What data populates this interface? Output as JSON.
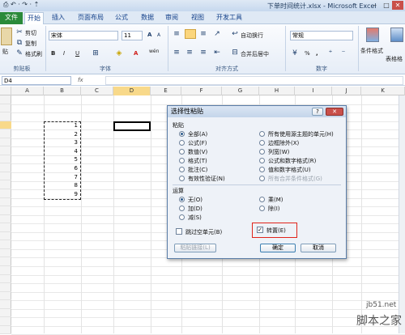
{
  "window": {
    "title": "下单时间统计.xlsx - Microsoft Excel",
    "qat": "⎙ ↶ · ↷ · ⇡"
  },
  "tabs": [
    {
      "label": "文件"
    },
    {
      "label": "开始"
    },
    {
      "label": "插入"
    },
    {
      "label": "页面布局"
    },
    {
      "label": "公式"
    },
    {
      "label": "数据"
    },
    {
      "label": "审阅"
    },
    {
      "label": "视图"
    },
    {
      "label": "开发工具"
    }
  ],
  "ribbon": {
    "clipboard": {
      "paste": "贴",
      "cut": "剪切",
      "copy": "复制",
      "format_painter": "格式刷",
      "label": "剪贴板"
    },
    "font": {
      "name": "宋体",
      "size": "11",
      "bold": "B",
      "italic": "I",
      "underline": "U",
      "grow": "A",
      "shrink": "A",
      "font_color": "A",
      "wen": "wén",
      "label": "字体"
    },
    "alignment": {
      "wrap": "自动换行",
      "merge": "合并后居中",
      "label": "对齐方式"
    },
    "number": {
      "format": "常规",
      "percent": "%",
      "comma": ",",
      "label": "数字"
    },
    "styles": {
      "conditional": "条件格式",
      "table": "表格格"
    }
  },
  "formula_bar": {
    "name_box": "D4",
    "fx": "fx",
    "formula": ""
  },
  "grid": {
    "columns": [
      "A",
      "B",
      "C",
      "D",
      "E",
      "F",
      "G",
      "H",
      "I",
      "J",
      "K"
    ],
    "rows": [
      "1",
      "2",
      "3",
      "4",
      "5",
      "6",
      "7",
      "8",
      "9",
      "10",
      "11",
      "12",
      "13",
      "14",
      "15",
      "16",
      "17",
      "18",
      "19",
      "20",
      "21",
      "22",
      "23",
      "24",
      "25",
      "26",
      "27",
      "28"
    ],
    "values": [
      "1",
      "2",
      "3",
      "4",
      "5",
      "6",
      "7",
      "8",
      "9"
    ]
  },
  "dialog": {
    "title": "选择性粘贴",
    "help": "?",
    "close": "✕",
    "paste_label": "粘贴",
    "paste_left": [
      {
        "label": "全部(A)",
        "selected": true
      },
      {
        "label": "公式(F)",
        "selected": false
      },
      {
        "label": "数值(V)",
        "selected": false
      },
      {
        "label": "格式(T)",
        "selected": false
      },
      {
        "label": "批注(C)",
        "selected": false
      },
      {
        "label": "有效性验证(N)",
        "selected": false
      }
    ],
    "paste_right": [
      {
        "label": "所有使用源主题的单元(H)",
        "disabled": false
      },
      {
        "label": "边框除外(X)",
        "disabled": false
      },
      {
        "label": "列宽(W)",
        "disabled": false
      },
      {
        "label": "公式和数字格式(R)",
        "disabled": false
      },
      {
        "label": "值和数字格式(U)",
        "disabled": false
      },
      {
        "label": "所有合并条件格式(G)",
        "disabled": true
      }
    ],
    "operation_label": "运算",
    "op_left": [
      {
        "label": "无(O)",
        "selected": true
      },
      {
        "label": "加(D)",
        "selected": false
      },
      {
        "label": "减(S)",
        "selected": false
      }
    ],
    "op_right": [
      {
        "label": "乘(M)"
      },
      {
        "label": "除(I)"
      }
    ],
    "skip_blanks": "跳过空单元(B)",
    "transpose": "转置(E)",
    "transpose_checked": "✓",
    "paste_link": "粘贴链接(L)",
    "ok": "确定",
    "cancel": "取消"
  },
  "watermark": {
    "line1": "jb51.net",
    "line2": "脚本之家"
  },
  "colors": {
    "file_tab": "#2a8a3a",
    "highlight": "#e0241b",
    "accent": "#15428b"
  }
}
